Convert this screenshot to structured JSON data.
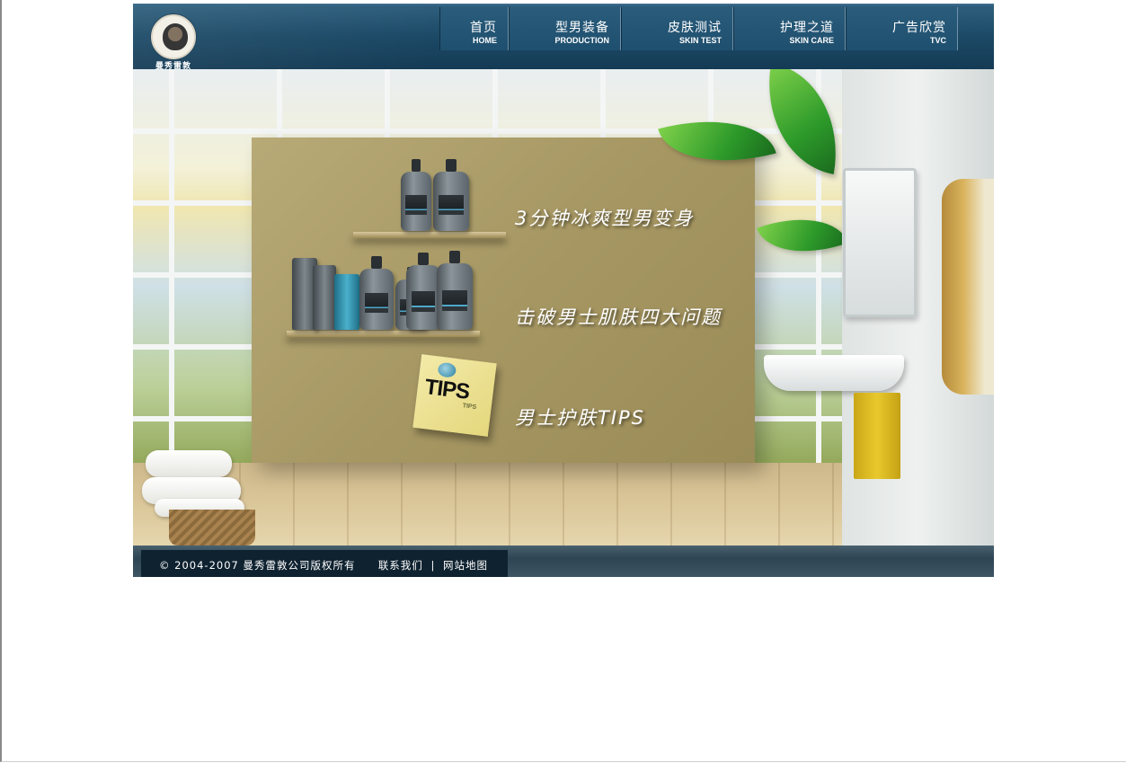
{
  "brand": {
    "logo_text": "曼秀雷敦"
  },
  "nav": [
    {
      "cn": "首页",
      "en": "HOME"
    },
    {
      "cn": "型男装备",
      "en": "PRODUCTION"
    },
    {
      "cn": "皮肤测试",
      "en": "SKIN TEST"
    },
    {
      "cn": "护理之道",
      "en": "SKIN CARE"
    },
    {
      "cn": "广告欣赏",
      "en": "TVC"
    }
  ],
  "hero": {
    "links": [
      "3分钟冰爽型男变身",
      "击破男士肌肤四大问题",
      "男士护肤TIPS"
    ],
    "tips_note": {
      "big": "TIPS",
      "small": "TIPS"
    }
  },
  "footer": {
    "copyright": "© 2004-2007 曼秀雷敦公司版权所有",
    "contact": "联系我们",
    "separator": "|",
    "sitemap": "网站地图"
  },
  "colors": {
    "header_bg": "#1c4a67",
    "footer_bar": "#0f2230",
    "tips_note": "#e4d77d",
    "wall_panel": "#a69763"
  }
}
